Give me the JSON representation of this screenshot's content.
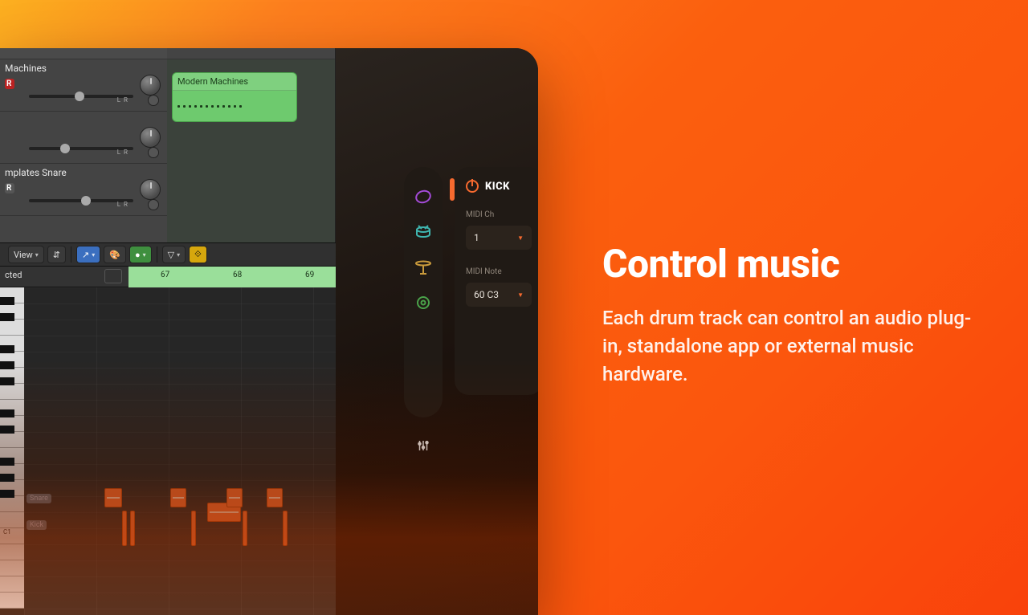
{
  "marketing": {
    "headline": "Control music",
    "body": "Each drum track can control an audio plug-in, standalone app or external music hardware."
  },
  "daw": {
    "tracks": [
      {
        "title": "Machines",
        "rec_label": "R"
      },
      {
        "title": "",
        "rec_label": ""
      },
      {
        "title": "mplates Snare",
        "rec_label": "R"
      }
    ],
    "clip_title": "Modern Machines",
    "toolbar": {
      "view_label": "View"
    },
    "selected_label": "cted",
    "ruler_marks": [
      "67",
      "68",
      "69"
    ],
    "piano_labels": {
      "snare": "Snare",
      "kick": "Kick",
      "c1": "C1"
    }
  },
  "plugin": {
    "track_name": "KICK",
    "midi_ch_label": "MIDI Ch",
    "midi_ch_value": "1",
    "midi_note_label": "MIDI Note",
    "midi_note_value": "60 C3",
    "icons": {
      "loop": "loop-icon",
      "drum": "drum-icon",
      "cymbal": "cymbal-icon",
      "gear": "gear-icon",
      "sliders": "sliders-icon"
    }
  }
}
